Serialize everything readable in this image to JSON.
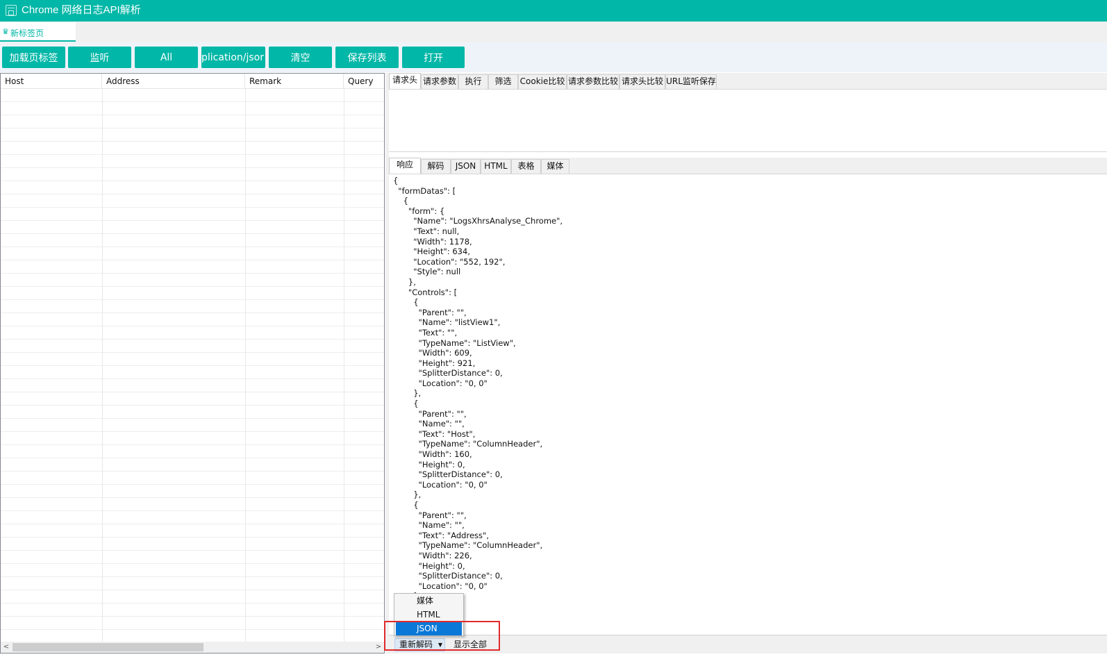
{
  "window": {
    "title": "Chrome 网络日志API解析"
  },
  "tab": {
    "icon": "leaf-icon",
    "label": "新标签页"
  },
  "toolbar": {
    "buttons": [
      "加载页标签",
      "监听",
      "All",
      "pplication/jsor",
      "清空",
      "保存列表",
      "打开"
    ]
  },
  "listview": {
    "columns": [
      "Host",
      "Address",
      "Remark",
      "Query"
    ]
  },
  "request_tabs": [
    "请求头",
    "请求参数",
    "执行",
    "筛选",
    "Cookie比较",
    "请求参数比较",
    "请求头比较",
    "URL监听保存"
  ],
  "response_tabs": [
    "响应",
    "解码",
    "JSON",
    "HTML",
    "表格",
    "媒体"
  ],
  "response": {
    "json_text": "{\n  \"formDatas\": [\n    {\n      \"form\": {\n        \"Name\": \"LogsXhrsAnalyse_Chrome\",\n        \"Text\": null,\n        \"Width\": 1178,\n        \"Height\": 634,\n        \"Location\": \"552, 192\",\n        \"Style\": null\n      },\n      \"Controls\": [\n        {\n          \"Parent\": \"\",\n          \"Name\": \"listView1\",\n          \"Text\": \"\",\n          \"TypeName\": \"ListView\",\n          \"Width\": 609,\n          \"Height\": 921,\n          \"SplitterDistance\": 0,\n          \"Location\": \"0, 0\"\n        },\n        {\n          \"Parent\": \"\",\n          \"Name\": \"\",\n          \"Text\": \"Host\",\n          \"TypeName\": \"ColumnHeader\",\n          \"Width\": 160,\n          \"Height\": 0,\n          \"SplitterDistance\": 0,\n          \"Location\": \"0, 0\"\n        },\n        {\n          \"Parent\": \"\",\n          \"Name\": \"\",\n          \"Text\": \"Address\",\n          \"TypeName\": \"ColumnHeader\",\n          \"Width\": 226,\n          \"Height\": 0,\n          \"SplitterDistance\": 0,\n          \"Location\": \"0, 0\"\n        },"
  },
  "statusbar": {
    "redecode_label": "重新解码",
    "show_all_label": "显示全部"
  },
  "dropdown": {
    "items": [
      "媒体",
      "HTML",
      "JSON"
    ],
    "selected": "JSON"
  },
  "colors": {
    "accent": "#01b7a7",
    "selection": "#0a78d7",
    "highlight": "#e02a2a"
  }
}
